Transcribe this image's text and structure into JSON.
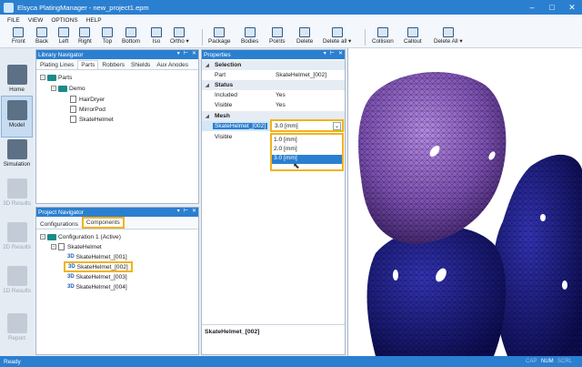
{
  "window": {
    "title": "Elsyca PlatingManager - new_project1.epm"
  },
  "menu": [
    "FILE",
    "VIEW",
    "OPTIONS",
    "HELP"
  ],
  "toolbar": {
    "view": [
      "Front",
      "Back",
      "Left",
      "Right",
      "Top",
      "Bottom",
      "Iso",
      "Ortho"
    ],
    "ortho_caret": "▾",
    "edit": [
      "Package",
      "Bodies",
      "Points",
      "Delete",
      "Delete all"
    ],
    "delete_all_caret": "▾",
    "analysis": [
      "Collision",
      "Callout",
      "Delete All"
    ],
    "delete_all2_caret": "▾"
  },
  "leftbar": [
    {
      "label": "Home",
      "enabled": true
    },
    {
      "label": "Model",
      "enabled": true,
      "active": true
    },
    {
      "label": "Simulation",
      "enabled": true
    },
    {
      "label": "3D Results",
      "enabled": false
    },
    {
      "label": "2D Results",
      "enabled": false
    },
    {
      "label": "1D Results",
      "enabled": false
    },
    {
      "label": "Report",
      "enabled": false
    }
  ],
  "library": {
    "title": "Library Navigator",
    "tabs": [
      "Plating Lines",
      "Parts",
      "Robbers",
      "Shields",
      "Aux Anodes"
    ],
    "active_tab": "Parts",
    "tree": {
      "root": "Parts",
      "folder": "Demo",
      "items": [
        "HairDryer",
        "MirrorPod",
        "SkateHelmet"
      ]
    }
  },
  "project": {
    "title": "Project Navigator",
    "tabs": [
      "Configurations",
      "Components"
    ],
    "active_tab": "Components",
    "tree": {
      "config": "Configuration 1 (Active)",
      "part": "SkateHelmet",
      "badge": "3D",
      "items": [
        "SkateHelmet_[001]",
        "SkateHelmet_[002]",
        "SkateHelmet_[003]",
        "SkateHelmet_[004]"
      ],
      "selected": "SkateHelmet_[002]"
    }
  },
  "properties": {
    "title": "Properties",
    "sections": {
      "selection": "Selection",
      "status": "Status",
      "mesh": "Mesh"
    },
    "rows": {
      "part_key": "Part",
      "part_val": "SkateHelmet_[002]",
      "included_key": "Included",
      "included_val": "Yes",
      "visible_key": "Visible",
      "visible_val": "Yes",
      "mesh_key": "SkateHelmet_[002]",
      "mesh_val": "3.0 [mm]",
      "mesh_visible_key": "Visible"
    },
    "dropdown_options": [
      "1.0 [mm]",
      "2.0 [mm]",
      "3.0 [mm]"
    ],
    "dropdown_selected": "3.0 [mm]",
    "footer": "SkateHelmet_[002]"
  },
  "status": {
    "text": "Ready",
    "indicators": [
      "CAP",
      "NUM",
      "SCRL"
    ]
  },
  "colors": {
    "accent": "#2b7fd0",
    "highlight": "#f2b21b",
    "mesh_purple": "#7b4fb0",
    "mesh_blue": "#1f1f8c"
  }
}
